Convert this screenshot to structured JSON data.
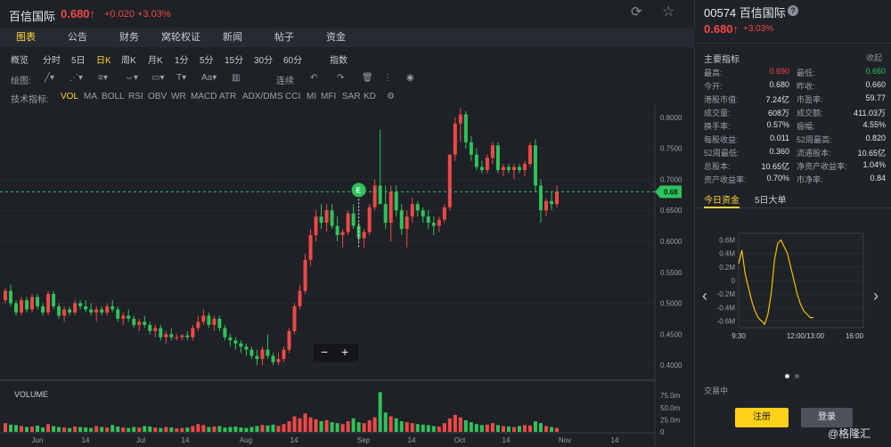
{
  "header": {
    "name": "百信国际",
    "price": "0.680↑",
    "change": "+0.020  +3.03%"
  },
  "tabs": [
    "图表",
    "公告",
    "财务",
    "窝轮权证",
    "新闻",
    "帖子",
    "资金"
  ],
  "periods": [
    "概览",
    "分时",
    "5日",
    "日K",
    "周K",
    "月K",
    "1分",
    "5分",
    "15分",
    "30分",
    "60分",
    "指数"
  ],
  "toolbar": {
    "draw_label": "绘图:",
    "continuous": "连续"
  },
  "indicators": {
    "label": "技术指标:",
    "items": [
      "VOL",
      "MA",
      "BOLL",
      "RSI",
      "OBV",
      "WR",
      "MACD",
      "ATR",
      "ADX/DMS",
      "CCI",
      "MI",
      "MFI",
      "SAR",
      "KD"
    ]
  },
  "chart_data": {
    "type": "candlestick",
    "y_ticks": [
      "0.8000",
      "0.7500",
      "0.7000",
      "0.6500",
      "0.6000",
      "0.5500",
      "0.5000",
      "0.4500",
      "0.4000"
    ],
    "ylim": [
      0.38,
      0.82
    ],
    "last_price_tag": "0.68",
    "event_marker": "E",
    "volume_label": "VOLUME",
    "volume_ticks": [
      "75.0m",
      "50.0m",
      "25.0m",
      "0"
    ],
    "x_labels": [
      "Jun",
      "14",
      "Jul",
      "14",
      "Aug",
      "14",
      "Sep",
      "14",
      "Oct",
      "14",
      "Nov",
      "14"
    ],
    "candles": [
      [
        0.505,
        0.525,
        0.5,
        0.52
      ],
      [
        0.52,
        0.53,
        0.495,
        0.5
      ],
      [
        0.5,
        0.505,
        0.48,
        0.485
      ],
      [
        0.485,
        0.51,
        0.48,
        0.505
      ],
      [
        0.505,
        0.51,
        0.485,
        0.49
      ],
      [
        0.49,
        0.515,
        0.485,
        0.51
      ],
      [
        0.51,
        0.515,
        0.49,
        0.495
      ],
      [
        0.495,
        0.5,
        0.48,
        0.485
      ],
      [
        0.485,
        0.52,
        0.48,
        0.515
      ],
      [
        0.515,
        0.52,
        0.49,
        0.495
      ],
      [
        0.495,
        0.5,
        0.475,
        0.48
      ],
      [
        0.48,
        0.495,
        0.47,
        0.49
      ],
      [
        0.49,
        0.495,
        0.48,
        0.485
      ],
      [
        0.485,
        0.505,
        0.48,
        0.5
      ],
      [
        0.5,
        0.505,
        0.49,
        0.495
      ],
      [
        0.495,
        0.505,
        0.485,
        0.49
      ],
      [
        0.49,
        0.5,
        0.48,
        0.485
      ],
      [
        0.485,
        0.495,
        0.47,
        0.49
      ],
      [
        0.49,
        0.495,
        0.48,
        0.485
      ],
      [
        0.485,
        0.5,
        0.48,
        0.495
      ],
      [
        0.495,
        0.505,
        0.485,
        0.49
      ],
      [
        0.49,
        0.495,
        0.47,
        0.475
      ],
      [
        0.475,
        0.485,
        0.465,
        0.48
      ],
      [
        0.48,
        0.49,
        0.47,
        0.475
      ],
      [
        0.475,
        0.48,
        0.46,
        0.465
      ],
      [
        0.465,
        0.475,
        0.455,
        0.47
      ],
      [
        0.47,
        0.48,
        0.46,
        0.465
      ],
      [
        0.465,
        0.47,
        0.45,
        0.455
      ],
      [
        0.455,
        0.465,
        0.445,
        0.46
      ],
      [
        0.46,
        0.465,
        0.44,
        0.445
      ],
      [
        0.445,
        0.455,
        0.435,
        0.45
      ],
      [
        0.45,
        0.46,
        0.44,
        0.445
      ],
      [
        0.445,
        0.45,
        0.44,
        0.445
      ],
      [
        0.445,
        0.45,
        0.44,
        0.448
      ],
      [
        0.448,
        0.455,
        0.44,
        0.445
      ],
      [
        0.445,
        0.465,
        0.44,
        0.46
      ],
      [
        0.46,
        0.48,
        0.455,
        0.47
      ],
      [
        0.47,
        0.49,
        0.465,
        0.48
      ],
      [
        0.48,
        0.485,
        0.46,
        0.465
      ],
      [
        0.465,
        0.48,
        0.455,
        0.475
      ],
      [
        0.475,
        0.48,
        0.455,
        0.46
      ],
      [
        0.46,
        0.465,
        0.44,
        0.445
      ],
      [
        0.445,
        0.45,
        0.43,
        0.44
      ],
      [
        0.44,
        0.445,
        0.425,
        0.435
      ],
      [
        0.435,
        0.44,
        0.42,
        0.43
      ],
      [
        0.43,
        0.435,
        0.415,
        0.425
      ],
      [
        0.425,
        0.43,
        0.41,
        0.415
      ],
      [
        0.415,
        0.425,
        0.4,
        0.41
      ],
      [
        0.41,
        0.43,
        0.4,
        0.425
      ],
      [
        0.425,
        0.45,
        0.41,
        0.415
      ],
      [
        0.415,
        0.42,
        0.4,
        0.405
      ],
      [
        0.405,
        0.42,
        0.4,
        0.41
      ],
      [
        0.41,
        0.43,
        0.405,
        0.425
      ],
      [
        0.425,
        0.46,
        0.42,
        0.455
      ],
      [
        0.455,
        0.5,
        0.45,
        0.495
      ],
      [
        0.495,
        0.53,
        0.49,
        0.52
      ],
      [
        0.52,
        0.58,
        0.515,
        0.57
      ],
      [
        0.57,
        0.62,
        0.56,
        0.61
      ],
      [
        0.61,
        0.65,
        0.6,
        0.64
      ],
      [
        0.64,
        0.66,
        0.62,
        0.63
      ],
      [
        0.63,
        0.66,
        0.615,
        0.65
      ],
      [
        0.65,
        0.66,
        0.62,
        0.625
      ],
      [
        0.625,
        0.64,
        0.6,
        0.61
      ],
      [
        0.61,
        0.62,
        0.59,
        0.615
      ],
      [
        0.615,
        0.65,
        0.61,
        0.645
      ],
      [
        0.645,
        0.66,
        0.62,
        0.625
      ],
      [
        0.625,
        0.63,
        0.6,
        0.605
      ],
      [
        0.605,
        0.62,
        0.59,
        0.615
      ],
      [
        0.615,
        0.66,
        0.61,
        0.655
      ],
      [
        0.655,
        0.7,
        0.65,
        0.69
      ],
      [
        0.69,
        0.78,
        0.67,
        0.66
      ],
      [
        0.66,
        0.69,
        0.62,
        0.63
      ],
      [
        0.63,
        0.69,
        0.6,
        0.68
      ],
      [
        0.68,
        0.69,
        0.64,
        0.65
      ],
      [
        0.65,
        0.66,
        0.61,
        0.62
      ],
      [
        0.62,
        0.65,
        0.59,
        0.64
      ],
      [
        0.64,
        0.67,
        0.63,
        0.66
      ],
      [
        0.66,
        0.665,
        0.64,
        0.65
      ],
      [
        0.65,
        0.655,
        0.63,
        0.64
      ],
      [
        0.64,
        0.65,
        0.62,
        0.63
      ],
      [
        0.63,
        0.64,
        0.61,
        0.625
      ],
      [
        0.625,
        0.64,
        0.615,
        0.635
      ],
      [
        0.635,
        0.66,
        0.63,
        0.655
      ],
      [
        0.655,
        0.7,
        0.65,
        0.74
      ],
      [
        0.74,
        0.8,
        0.73,
        0.79
      ],
      [
        0.79,
        0.815,
        0.76,
        0.805
      ],
      [
        0.805,
        0.81,
        0.75,
        0.76
      ],
      [
        0.76,
        0.77,
        0.73,
        0.74
      ],
      [
        0.74,
        0.75,
        0.715,
        0.72
      ],
      [
        0.72,
        0.73,
        0.71,
        0.715
      ],
      [
        0.715,
        0.74,
        0.71,
        0.735
      ],
      [
        0.735,
        0.76,
        0.725,
        0.755
      ],
      [
        0.755,
        0.76,
        0.71,
        0.715
      ],
      [
        0.715,
        0.725,
        0.705,
        0.72
      ],
      [
        0.72,
        0.725,
        0.71,
        0.715
      ],
      [
        0.715,
        0.725,
        0.7,
        0.72
      ],
      [
        0.72,
        0.725,
        0.71,
        0.715
      ],
      [
        0.715,
        0.73,
        0.705,
        0.725
      ],
      [
        0.725,
        0.76,
        0.72,
        0.755
      ],
      [
        0.755,
        0.765,
        0.68,
        0.69
      ],
      [
        0.69,
        0.7,
        0.63,
        0.65
      ],
      [
        0.65,
        0.67,
        0.64,
        0.665
      ],
      [
        0.665,
        0.68,
        0.65,
        0.66
      ],
      [
        0.66,
        0.69,
        0.655,
        0.68
      ]
    ],
    "volumes": [
      18,
      15,
      14,
      12,
      10,
      11,
      13,
      9,
      16,
      12,
      10,
      9,
      8,
      11,
      10,
      9,
      8,
      12,
      10,
      9,
      14,
      11,
      9,
      8,
      10,
      9,
      12,
      11,
      9,
      8,
      10,
      9,
      7,
      8,
      9,
      12,
      16,
      14,
      10,
      11,
      12,
      9,
      10,
      11,
      9,
      8,
      10,
      12,
      14,
      13,
      15,
      12,
      16,
      22,
      32,
      28,
      38,
      30,
      26,
      22,
      24,
      20,
      18,
      16,
      22,
      28,
      20,
      18,
      24,
      30,
      82,
      40,
      32,
      28,
      22,
      20,
      18,
      16,
      15,
      14,
      12,
      11,
      18,
      28,
      35,
      30,
      24,
      20,
      16,
      14,
      15,
      18,
      14,
      12,
      11,
      10,
      12,
      14,
      13,
      22,
      18,
      12,
      10,
      8
    ]
  },
  "right": {
    "code_name": "00574 百信国际",
    "price": "0.680↑",
    "change": "+3.03%",
    "section_title": "主要指标",
    "collapse": "收起",
    "indicators": [
      [
        "最高:",
        "0.690",
        "最低:",
        "0.660"
      ],
      [
        "今开:",
        "0.680",
        "昨收:",
        "0.660"
      ],
      [
        "港股市值:",
        "7.24亿",
        "市盈率:",
        "59.77"
      ],
      [
        "成交量:",
        "608万",
        "成交额:",
        "411.03万"
      ],
      [
        "换手率:",
        "0.57%",
        "振幅:",
        "4.55%"
      ],
      [
        "每股收益:",
        "0.011",
        "52周最高:",
        "0.820"
      ],
      [
        "52周最低:",
        "0.360",
        "流通股本:",
        "10.65亿"
      ],
      [
        "总股本:",
        "10.65亿",
        "净资产收益率:",
        "1.04%"
      ],
      [
        "资产收益率:",
        "0.70%",
        "市净率:",
        "0.84"
      ]
    ],
    "flow_tabs": [
      "今日资金",
      "5日大单"
    ],
    "flow_chart": {
      "type": "line",
      "y_ticks": [
        "0.6M",
        "0.4M",
        "0.2M",
        "0",
        "-0.2M",
        "-0.4M",
        "-0.6M"
      ],
      "x_ticks": [
        "9:30",
        "12:00/13:00",
        "16:00"
      ],
      "ylim": [
        -0.7,
        0.7
      ],
      "values": [
        0.25,
        0.45,
        0.1,
        -0.1,
        -0.3,
        -0.45,
        -0.55,
        -0.6,
        -0.65,
        -0.5,
        -0.2,
        0.3,
        0.55,
        0.6,
        0.5,
        0.4,
        0.2,
        0.0,
        -0.2,
        -0.35,
        -0.45,
        -0.5,
        -0.55,
        -0.55
      ]
    },
    "status": "交易中",
    "register": "注册",
    "login": "登录",
    "watermark": "@格隆汇"
  },
  "colors": {
    "up": "#f04848",
    "down": "#2fc25b",
    "accent": "#ffd43b",
    "flow_line": "#f2c200"
  },
  "icons": [
    "refresh-icon",
    "star-icon",
    "help-icon",
    "eye-icon",
    "undo-icon",
    "redo-icon",
    "trash-icon",
    "gear-icon",
    "chevron-left-icon",
    "chevron-right-icon"
  ]
}
